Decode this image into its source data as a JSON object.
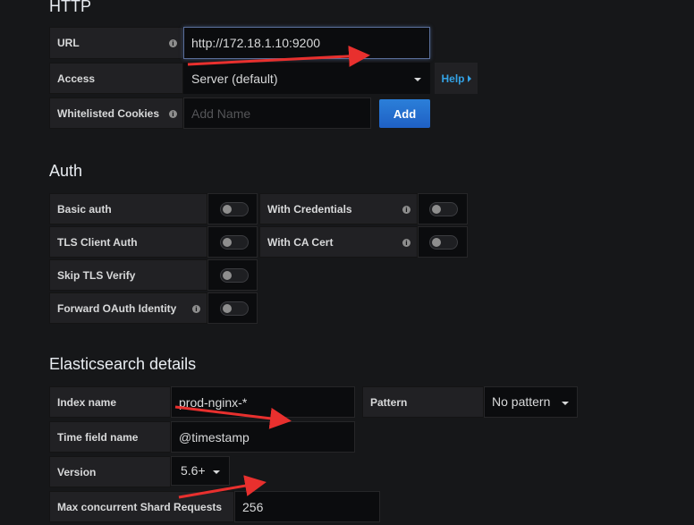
{
  "http": {
    "title": "HTTP",
    "url_label": "URL",
    "url_value": "http://172.18.1.10:9200",
    "access_label": "Access",
    "access_value": "Server (default)",
    "help_label": "Help",
    "cookies_label": "Whitelisted Cookies",
    "cookies_placeholder": "Add Name",
    "add_button": "Add"
  },
  "auth": {
    "title": "Auth",
    "basic_auth": "Basic auth",
    "with_credentials": "With Credentials",
    "tls_client_auth": "TLS Client Auth",
    "with_ca_cert": "With CA Cert",
    "skip_tls_verify": "Skip TLS Verify",
    "forward_oauth": "Forward OAuth Identity",
    "toggles": {
      "basic_auth": false,
      "with_credentials": false,
      "tls_client_auth": false,
      "with_ca_cert": false,
      "skip_tls_verify": false,
      "forward_oauth": false
    }
  },
  "elasticsearch": {
    "title": "Elasticsearch details",
    "index_name_label": "Index name",
    "index_name_value": "prod-nginx-*",
    "pattern_label": "Pattern",
    "pattern_value": "No pattern",
    "time_field_label": "Time field name",
    "time_field_value": "@timestamp",
    "version_label": "Version",
    "version_value": "5.6+",
    "max_shard_label": "Max concurrent Shard Requests",
    "max_shard_value": "256"
  },
  "icons": {
    "info": "info-icon",
    "caret": "caret-down-icon",
    "help_caret": "caret-right-icon",
    "annotation": "red-arrow-annotation"
  },
  "colors": {
    "background": "#161719",
    "label_bg": "#212124",
    "input_bg": "#0b0c0e",
    "primary": "#1f60c4",
    "link": "#33a2e5",
    "annotation": "#e8302e"
  }
}
